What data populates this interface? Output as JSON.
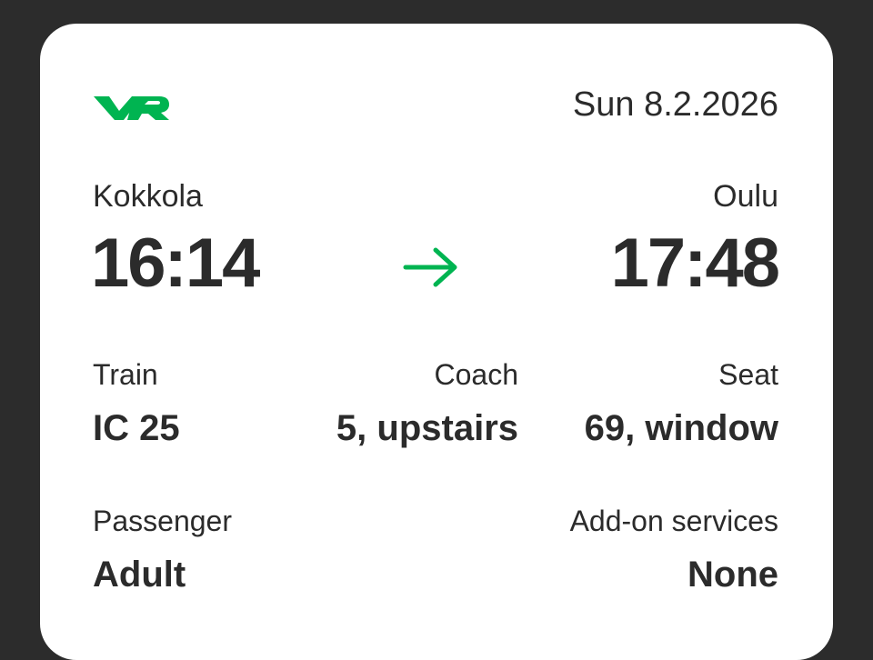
{
  "ticket": {
    "brand_logo": "VR",
    "accent_color": "#00b451",
    "date": "Sun 8.2.2026",
    "departure": {
      "station": "Kokkola",
      "time": "16:14"
    },
    "arrow_icon": "arrow-right-icon",
    "arrival": {
      "station": "Oulu",
      "time": "17:48"
    },
    "train": {
      "label": "Train",
      "value": "IC 25"
    },
    "coach": {
      "label": "Coach",
      "value": "5, upstairs"
    },
    "seat": {
      "label": "Seat",
      "value": "69, window"
    },
    "passenger": {
      "label": "Passenger",
      "value": "Adult"
    },
    "addons": {
      "label": "Add-on services",
      "value": "None"
    }
  }
}
